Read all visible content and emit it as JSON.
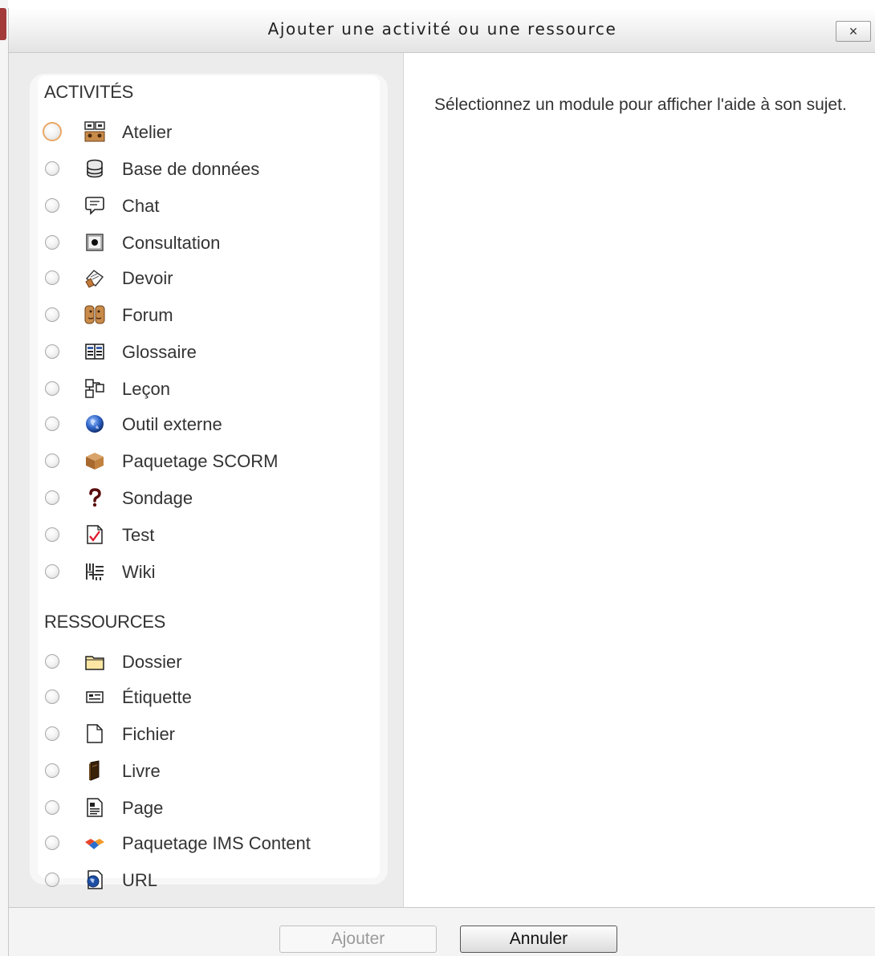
{
  "dialog": {
    "title": "Ajouter une activité ou une ressource",
    "close_label": "×"
  },
  "sections": {
    "activities_heading": "ACTIVITÉS",
    "resources_heading": "RESSOURCES"
  },
  "activities": [
    {
      "label": "Atelier",
      "icon": "workshop-icon"
    },
    {
      "label": "Base de données",
      "icon": "database-icon"
    },
    {
      "label": "Chat",
      "icon": "chat-icon"
    },
    {
      "label": "Consultation",
      "icon": "choice-icon"
    },
    {
      "label": "Devoir",
      "icon": "assignment-icon"
    },
    {
      "label": "Forum",
      "icon": "forum-icon"
    },
    {
      "label": "Glossaire",
      "icon": "glossary-icon"
    },
    {
      "label": "Leçon",
      "icon": "lesson-icon"
    },
    {
      "label": "Outil externe",
      "icon": "globe-icon"
    },
    {
      "label": "Paquetage SCORM",
      "icon": "box-icon"
    },
    {
      "label": "Sondage",
      "icon": "question-mark-icon"
    },
    {
      "label": "Test",
      "icon": "quiz-check-icon"
    },
    {
      "label": "Wiki",
      "icon": "wiki-icon"
    }
  ],
  "resources": [
    {
      "label": "Dossier",
      "icon": "folder-icon"
    },
    {
      "label": "Étiquette",
      "icon": "label-icon"
    },
    {
      "label": "Fichier",
      "icon": "file-icon"
    },
    {
      "label": "Livre",
      "icon": "book-icon"
    },
    {
      "label": "Page",
      "icon": "page-icon"
    },
    {
      "label": "Paquetage IMS Content",
      "icon": "ims-package-icon"
    },
    {
      "label": "URL",
      "icon": "url-icon"
    }
  ],
  "help": {
    "text": "Sélectionnez un module pour afficher l'aide à son sujet."
  },
  "footer": {
    "add_label": "Ajouter",
    "cancel_label": "Annuler"
  },
  "colors": {
    "accent_red": "#a33b3b",
    "focus_ring": "#e9a865"
  }
}
